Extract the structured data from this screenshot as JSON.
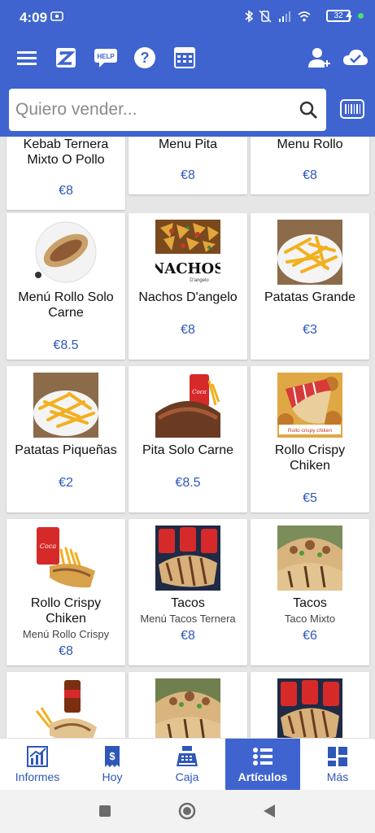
{
  "status_bar": {
    "time": "4:09",
    "battery": "32"
  },
  "search": {
    "placeholder": "Quiero vender..."
  },
  "colors": {
    "primary": "#3f64cf",
    "price": "#2f57b8",
    "accent_green": "#4be071"
  },
  "toolbar_icons": [
    "menu-icon",
    "app-logo-icon",
    "help-chat-icon",
    "question-icon",
    "calendar-grid-icon",
    "add-user-icon",
    "cloud-check-icon",
    "barcode-icon"
  ],
  "products": [
    {
      "name": "Kebab Ternera Mixto O Pollo",
      "subtitle": "",
      "price": "€8",
      "image": "kebab"
    },
    {
      "name": "Menu Pita",
      "subtitle": "",
      "price": "€8",
      "image": "pita"
    },
    {
      "name": "Menu Rollo",
      "subtitle": "",
      "price": "€8",
      "image": "rollo"
    },
    {
      "name": "Menú Rollo Solo Carne",
      "subtitle": "",
      "price": "€8.5",
      "image": "wrap-plate"
    },
    {
      "name": "Nachos D'angelo",
      "subtitle": "",
      "price": "€8",
      "image": "nachos"
    },
    {
      "name": "Patatas Grande",
      "subtitle": "",
      "price": "€3",
      "image": "fries"
    },
    {
      "name": "Patatas Piqueñas",
      "subtitle": "",
      "price": "€2",
      "image": "fries-small"
    },
    {
      "name": "Pita Solo Carne",
      "subtitle": "",
      "price": "€8.5",
      "image": "pita-cola"
    },
    {
      "name": "Rollo Crispy Chiken",
      "subtitle": "",
      "price": "€5",
      "image": "crispy"
    },
    {
      "name": "Rollo Crispy Chiken",
      "subtitle": "Menú Rollo Crispy",
      "price": "€8",
      "image": "crispy-cola"
    },
    {
      "name": "Tacos",
      "subtitle": "Menú Tacos Ternera",
      "price": "€8",
      "image": "tacos-cola"
    },
    {
      "name": "Tacos",
      "subtitle": "Taco Mixto",
      "price": "€6",
      "image": "tacos"
    },
    {
      "name": "",
      "subtitle": "",
      "price": "",
      "image": "wrap-cola"
    },
    {
      "name": "",
      "subtitle": "",
      "price": "",
      "image": "tacos-2"
    },
    {
      "name": "",
      "subtitle": "",
      "price": "",
      "image": "tacos-cola-2"
    }
  ],
  "nachos_label": {
    "title": "NACHOS",
    "sub": "D'angelo"
  },
  "crispy_label": "Rollo crispy chiken",
  "bottom_nav": [
    {
      "label": "Informes",
      "icon": "chart-icon"
    },
    {
      "label": "Hoy",
      "icon": "receipt-icon"
    },
    {
      "label": "Caja",
      "icon": "cash-register-icon"
    },
    {
      "label": "Artículos",
      "icon": "items-list-icon",
      "active": true
    },
    {
      "label": "Más",
      "icon": "grid-icon"
    }
  ]
}
